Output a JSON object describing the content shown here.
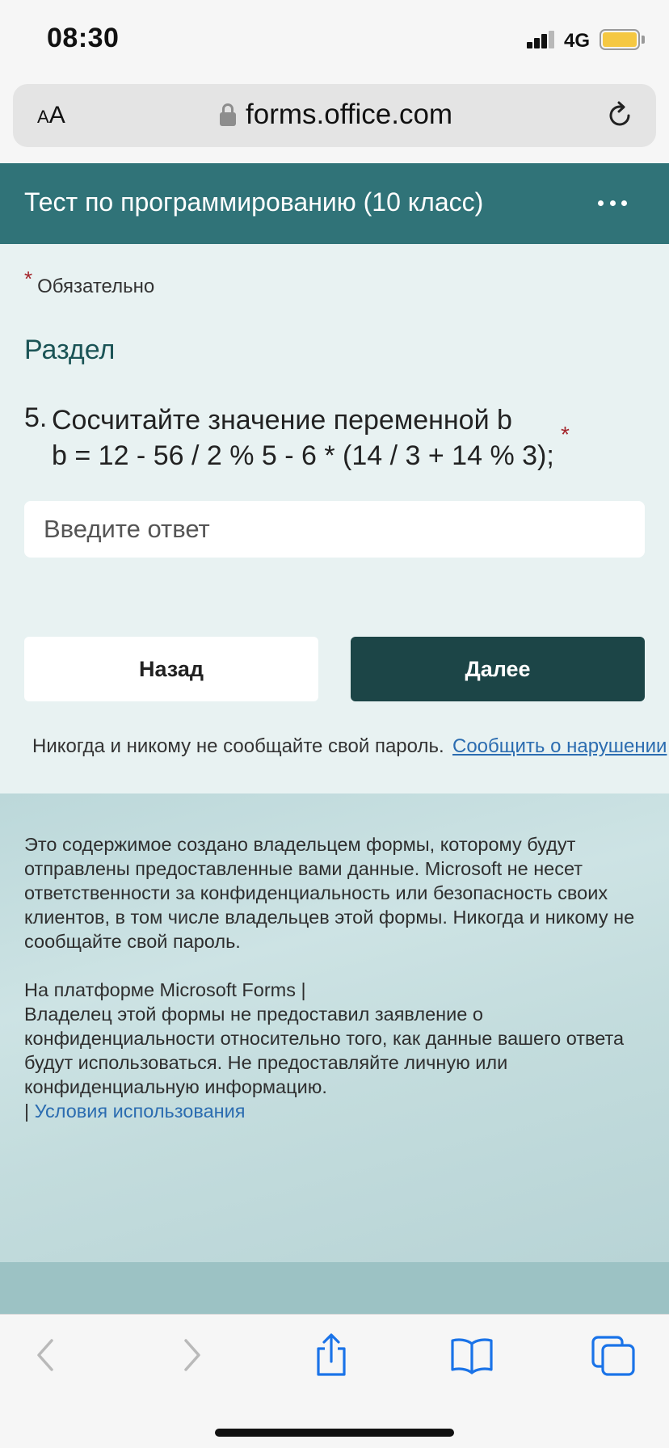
{
  "status_bar": {
    "time": "08:30",
    "network": "4G",
    "battery_color": "#f5c842"
  },
  "address_bar": {
    "reader_small": "A",
    "reader_big": "A",
    "url": "forms.office.com",
    "lock_icon": "lock-icon",
    "reload_icon": "reload-icon"
  },
  "form_header": {
    "title": "Тест по программированию (10 класс)",
    "more_icon": "more-icon",
    "background": "#307378"
  },
  "form": {
    "required_star": "*",
    "required_label": "Обязательно",
    "section_title": "Раздел",
    "question": {
      "number": "5.",
      "line1": "Сосчитайте значение переменной b",
      "line2": "b = 12 - 56 / 2 % 5 - 6 * (14 / 3 + 14 % 3);",
      "required_star": "*"
    },
    "answer": {
      "placeholder": "Введите ответ",
      "value": ""
    },
    "back_label": "Назад",
    "next_label": "Далее",
    "password_note": "Никогда и никому не сообщайте свой пароль.",
    "report_link": "Сообщить о нарушении"
  },
  "footer": {
    "disclaimer": "Это содержимое создано владельцем формы, которому будут отправлены предоставленные вами данные. Microsoft не несет ответственности за конфиденциальность или безопасность своих клиентов, в том числе владельцев этой формы. Никогда и никому не сообщайте свой пароль.",
    "platform": "На платформе Microsoft Forms |",
    "privacy": "Владелец этой формы не предоставил заявление о конфиденциальности относительно того, как данные вашего ответа будут использоваться. Не предоставляйте личную или конфиденциальную информацию.",
    "terms_prefix": "| ",
    "terms_link": "Условия использования"
  },
  "toolbar": {
    "icons": [
      "back-arrow-icon",
      "forward-arrow-icon",
      "share-icon",
      "bookmarks-icon",
      "tabs-icon"
    ],
    "accent": "#1a73e8"
  }
}
